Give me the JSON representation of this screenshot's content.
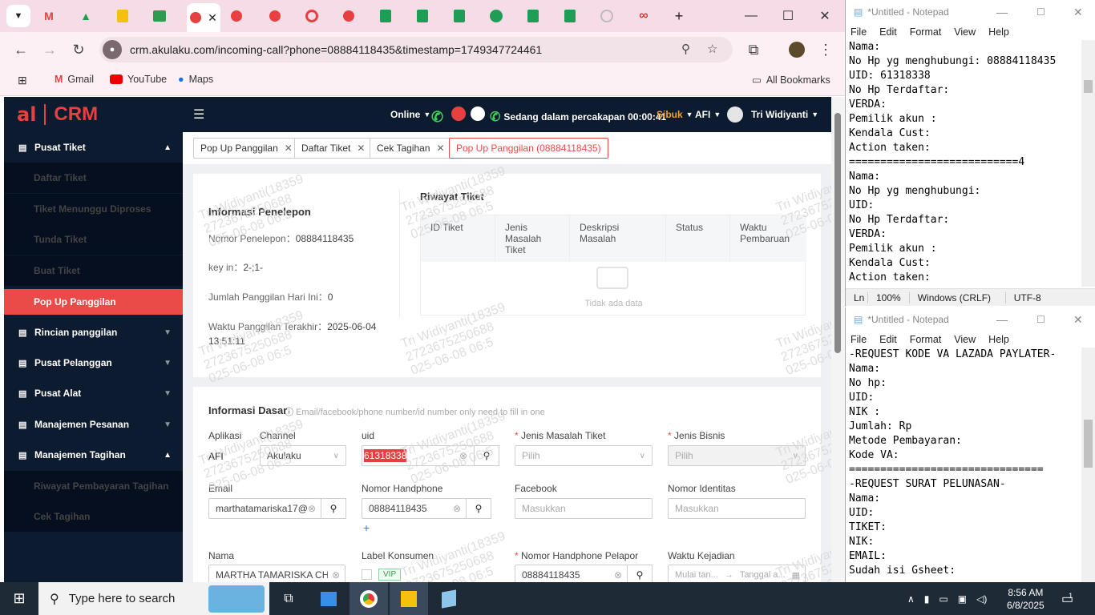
{
  "browser": {
    "url": "crm.akulaku.com/incoming-call?phone=08884118435&timestamp=1749347724461",
    "bookmarks": [
      "Gmail",
      "YouTube",
      "Maps"
    ],
    "all_bookmarks": "All Bookmarks"
  },
  "crm": {
    "logo_al": "al",
    "logo_sub": "finance",
    "logo_crm": "CRM",
    "top": {
      "online": "Online",
      "call_status": "Sedang dalam percakapan 00:00:41",
      "busy": "Sibuk",
      "app": "AFI",
      "user": "Tri Widiyanti"
    },
    "sidebar": [
      {
        "label": "Pusat Tiket",
        "type": "group",
        "expanded": true
      },
      {
        "label": "Daftar Tiket",
        "type": "sub"
      },
      {
        "label": "Tiket Menunggu Diproses",
        "type": "sub"
      },
      {
        "label": "Tunda Tiket",
        "type": "sub"
      },
      {
        "label": "Buat Tiket",
        "type": "sub"
      },
      {
        "label": "Pop Up Panggilan",
        "type": "sub",
        "active": true
      },
      {
        "label": "Rincian panggilan",
        "type": "group"
      },
      {
        "label": "Pusat Pelanggan",
        "type": "group"
      },
      {
        "label": "Pusat Alat",
        "type": "group"
      },
      {
        "label": "Manajemen Pesanan",
        "type": "group"
      },
      {
        "label": "Manajemen Tagihan",
        "type": "group",
        "expanded": true
      },
      {
        "label": "Riwayat Pembayaran Tagihan",
        "type": "sub"
      },
      {
        "label": "Cek Tagihan",
        "type": "sub"
      }
    ],
    "page_tabs": [
      "Pop Up Panggilan",
      "Daftar Tiket",
      "Cek Tagihan",
      "Pop Up Panggilan (08884118435)"
    ],
    "caller": {
      "title": "Informasi Penelepon",
      "phone_label": "Nomor Penelepon：",
      "phone": "08884118435",
      "keyin_label": "key in：",
      "keyin": "2-;1-",
      "calls_today_label": "Jumlah Panggilan Hari Ini：",
      "calls_today": "0",
      "last_call_label": "Waktu Panggilan Terakhir：",
      "last_call_date": "2025-06-04",
      "last_call_time": "13:51:11"
    },
    "history": {
      "title": "Riwayat Tiket",
      "columns": [
        "ID Tiket",
        "Jenis Masalah Tiket",
        "Deskripsi Masalah",
        "Status",
        "Waktu Pembaruan"
      ],
      "empty": "Tidak ada data"
    },
    "basic": {
      "title": "Informasi Dasar",
      "hint": "Email/facebook/phone number/id number only need to fill in one",
      "aplikasi_label": "Aplikasi",
      "aplikasi": "AFI",
      "channel_label": "Channel",
      "channel": "Akulaku",
      "uid_label": "uid",
      "uid": "61318338",
      "jenis_masalah_label": "Jenis Masalah Tiket",
      "jenis_masalah_ph": "Pilih",
      "jenis_bisnis_label": "Jenis Bisnis",
      "jenis_bisnis_ph": "Pilih",
      "email_label": "Email",
      "email": "marthatamariska17@",
      "hp_label": "Nomor Handphone",
      "hp": "08884118435",
      "facebook_label": "Facebook",
      "facebook_ph": "Masukkan",
      "identitas_label": "Nomor Identitas",
      "identitas_ph": "Masukkan",
      "nama_label": "Nama",
      "nama": "MARTHA TAMARISKA CHRI",
      "label_konsumen_label": "Label Konsumen",
      "vip": "VIP",
      "hp_pelapor_label": "Nomor Handphone Pelapor",
      "hp_pelapor": "08884118435",
      "waktu_label": "Waktu Kejadian",
      "waktu_start_ph": "Mulai tan...",
      "waktu_end_ph": "Tanggal a..."
    },
    "watermark": "Tri Widiyanti(18359\n2723675250688\n025-06-08 06:5"
  },
  "notepad1": {
    "title": "*Untitled - Notepad",
    "menu": [
      "File",
      "Edit",
      "Format",
      "View",
      "Help"
    ],
    "lines": [
      "Nama:",
      "No Hp yg menghubungi: 08884118435",
      "UID: 61318338",
      "No Hp Terdaftar:",
      "VERDA:",
      "Pemilik akun :",
      "Kendala Cust:",
      "Action taken:",
      "===========================4",
      "Nama:",
      "No Hp yg menghubungi:",
      "UID:",
      "No Hp Terdaftar:",
      "VERDA:",
      "Pemilik akun :",
      "Kendala Cust:",
      "Action taken:"
    ],
    "status": [
      "Ln",
      "100%",
      "Windows (CRLF)",
      "UTF-8"
    ]
  },
  "notepad2": {
    "title": "*Untitled - Notepad",
    "menu": [
      "File",
      "Edit",
      "Format",
      "View",
      "Help"
    ],
    "lines": [
      "-REQUEST KODE VA LAZADA PAYLATER-",
      "Nama:",
      "No hp:",
      "UID:",
      "NIK :",
      "Jumlah: Rp",
      "Metode Pembayaran:",
      "Kode VA:",
      "===============================",
      "-REQUEST SURAT PELUNASAN-",
      "Nama:",
      "UID:",
      "TIKET:",
      "NIK:",
      "EMAIL:",
      "Sudah isi Gsheet:"
    ]
  },
  "taskbar": {
    "search": "Type here to search",
    "time": "8:56 AM",
    "date": "6/8/2025",
    "notifications": "1"
  }
}
